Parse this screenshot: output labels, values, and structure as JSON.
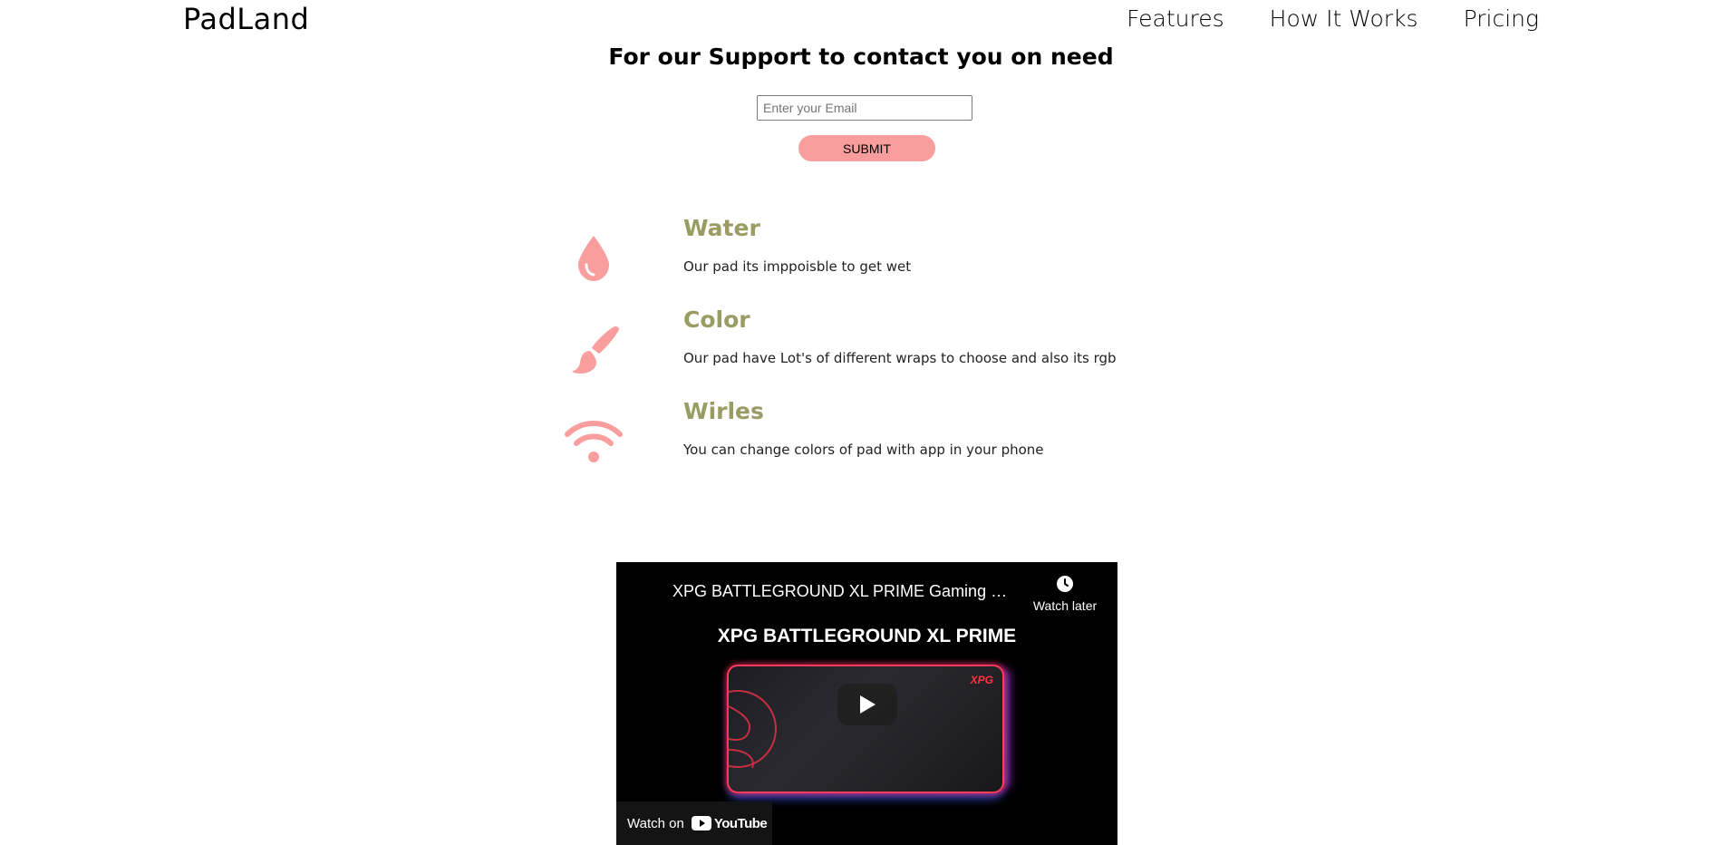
{
  "brand": {
    "logo": "PadLand"
  },
  "nav": {
    "items": [
      "Features",
      "How It Works",
      "Pricing"
    ]
  },
  "support": {
    "title": "For our Support to contact you on need",
    "email_placeholder": "Enter your Email",
    "submit_label": "SUBMIT"
  },
  "features": [
    {
      "icon": "water-drop-icon",
      "title": "Water",
      "description": "Our pad its imppoisble to get wet"
    },
    {
      "icon": "paint-brush-icon",
      "title": "Color",
      "description": "Our pad have Lot's of different wraps to choose and also its rgb"
    },
    {
      "icon": "wifi-icon",
      "title": "Wirles",
      "description": "You can change colors of pad with app in your phone"
    }
  ],
  "video": {
    "title": "XPG BATTLEGROUND XL PRIME Gaming Mou...",
    "watch_later": "Watch later",
    "headline": "XPG BATTLEGROUND XL PRIME",
    "pad_brand": "XPG",
    "watch_on": "Watch on",
    "youtube": "YouTube"
  },
  "colors": {
    "accent": "#f99d9d",
    "feature_title": "#9a9c64"
  }
}
